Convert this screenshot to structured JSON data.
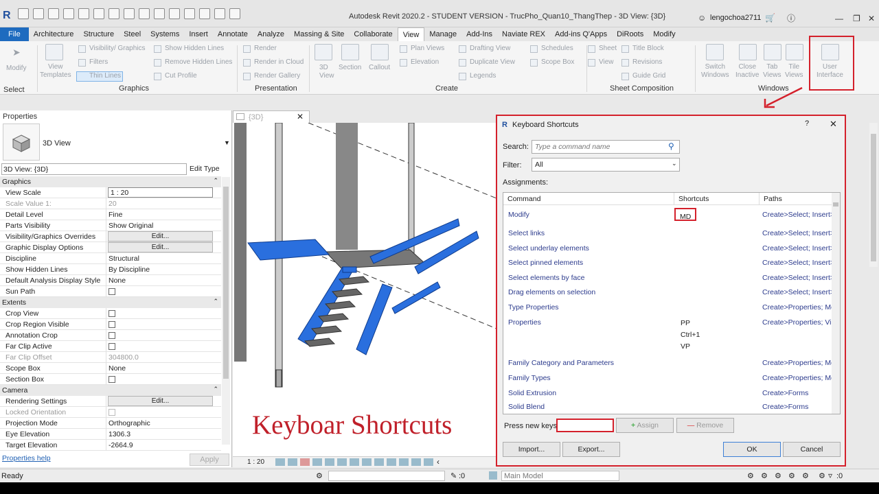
{
  "app": {
    "title": "Autodesk Revit 2020.2 - STUDENT VERSION - TrucPho_Quan10_ThangThep - 3D View: {3D}",
    "user": "lengochoa2711"
  },
  "tabs": [
    "File",
    "Architecture",
    "Structure",
    "Steel",
    "Systems",
    "Insert",
    "Annotate",
    "Analyze",
    "Massing & Site",
    "Collaborate",
    "View",
    "Manage",
    "Add-Ins",
    "Naviate REX",
    "Add-ins Q'Apps",
    "DiRoots",
    "Modify"
  ],
  "ribbon": {
    "modify": "Modify",
    "select": "Select",
    "view_templates": "View\nTemplates",
    "vg": "Visibility/ Graphics",
    "filters": "Filters",
    "thin_lines": "Thin  Lines",
    "show_hidden": "Show  Hidden Lines",
    "remove_hidden": "Remove  Hidden Lines",
    "cut_profile": "Cut  Profile",
    "render": "Render",
    "render_cloud": "Render  in Cloud",
    "render_gallery": "Render  Gallery",
    "view3d": "3D\nView",
    "section": "Section",
    "callout": "Callout",
    "plan_views": "Plan  Views",
    "elevation": "Elevation",
    "drafting_view": "Drafting  View",
    "duplicate_view": "Duplicate  View",
    "legends": "Legends",
    "schedules": "Schedules",
    "scope_box": "Scope  Box",
    "sheet": "Sheet",
    "view": "View",
    "title_block": "Title  Block",
    "revisions": "Revisions",
    "guide_grid": "Guide  Grid",
    "switch_windows": "Switch\nWindows",
    "close_inactive": "Close\nInactive",
    "tab_views": "Tab\nViews",
    "tile_views": "Tile\nViews",
    "user_interface": "User\nInterface",
    "panels": {
      "graphics": "Graphics",
      "presentation": "Presentation",
      "create": "Create",
      "sheet_composition": "Sheet Composition",
      "windows": "Windows"
    }
  },
  "properties": {
    "header": "Properties",
    "type_name": "3D View",
    "selector": "3D View: {3D}",
    "edit_type": "Edit Type",
    "groups": {
      "graphics": "Graphics",
      "extents": "Extents",
      "camera": "Camera"
    },
    "rows": {
      "view_scale": [
        "View Scale",
        "1 : 20"
      ],
      "scale_value": [
        "Scale Value    1:",
        "20"
      ],
      "detail_level": [
        "Detail Level",
        "Fine"
      ],
      "parts_visibility": [
        "Parts Visibility",
        "Show Original"
      ],
      "vg_overrides": [
        "Visibility/Graphics Overrides",
        "Edit..."
      ],
      "graphic_display": [
        "Graphic Display Options",
        "Edit..."
      ],
      "discipline": [
        "Discipline",
        "Structural"
      ],
      "show_hidden": [
        "Show Hidden Lines",
        "By Discipline"
      ],
      "default_analysis": [
        "Default Analysis Display Style",
        "None"
      ],
      "sun_path": [
        "Sun Path",
        ""
      ],
      "crop_view": [
        "Crop View",
        ""
      ],
      "crop_region": [
        "Crop Region Visible",
        ""
      ],
      "annotation_crop": [
        "Annotation Crop",
        ""
      ],
      "far_clip_active": [
        "Far Clip Active",
        ""
      ],
      "far_clip_offset": [
        "Far Clip Offset",
        "304800.0"
      ],
      "scope_box": [
        "Scope Box",
        "None"
      ],
      "section_box": [
        "Section Box",
        ""
      ],
      "rendering": [
        "Rendering Settings",
        "Edit..."
      ],
      "locked_orientation": [
        "Locked Orientation",
        ""
      ],
      "projection_mode": [
        "Projection Mode",
        "Orthographic"
      ],
      "eye_elevation": [
        "Eye Elevation",
        "1306.3"
      ],
      "target_elevation": [
        "Target Elevation",
        "-2664.9"
      ]
    },
    "help": "Properties help",
    "apply": "Apply"
  },
  "viewport": {
    "tab": "{3D}",
    "scale": "1 : 20",
    "caption": "Keyboar Shortcuts"
  },
  "dialog": {
    "title": "Keyboard Shortcuts",
    "search_label": "Search:",
    "search_placeholder": "Type a command name",
    "filter_label": "Filter:",
    "filter_value": "All",
    "assignments_label": "Assignments:",
    "columns": [
      "Command",
      "Shortcuts",
      "Paths"
    ],
    "rows": [
      {
        "command": "Modify",
        "shortcut": "MD",
        "path": "Create>Select; Insert>S"
      },
      {
        "command": "Select links",
        "shortcut": "",
        "path": "Create>Select; Insert>S"
      },
      {
        "command": "Select underlay elements",
        "shortcut": "",
        "path": "Create>Select; Insert>S"
      },
      {
        "command": "Select pinned elements",
        "shortcut": "",
        "path": "Create>Select; Insert>S"
      },
      {
        "command": "Select elements by face",
        "shortcut": "",
        "path": "Create>Select; Insert>S"
      },
      {
        "command": "Drag elements on selection",
        "shortcut": "",
        "path": "Create>Select; Insert>S"
      },
      {
        "command": "Type Properties",
        "shortcut": "",
        "path": "Create>Properties; Mo"
      },
      {
        "command": "Properties",
        "shortcut": "PP\nCtrl+1\nVP",
        "path": "Create>Properties; View"
      },
      {
        "command": "Family Category and Parameters",
        "shortcut": "",
        "path": "Create>Properties; Mo"
      },
      {
        "command": "Family Types",
        "shortcut": "",
        "path": "Create>Properties; Mo"
      },
      {
        "command": "Solid Extrusion",
        "shortcut": "",
        "path": "Create>Forms"
      },
      {
        "command": "Solid Blend",
        "shortcut": "",
        "path": "Create>Forms"
      }
    ],
    "press_new_keys": "Press new keys:",
    "assign": "Assign",
    "remove": "Remove",
    "import": "Import...",
    "export": "Export...",
    "ok": "OK",
    "cancel": "Cancel",
    "help": "?",
    "close": "✕"
  },
  "status": {
    "ready": "Ready",
    "main_model": "Main Model",
    "zero1": ":0",
    "zero2": ":0"
  }
}
